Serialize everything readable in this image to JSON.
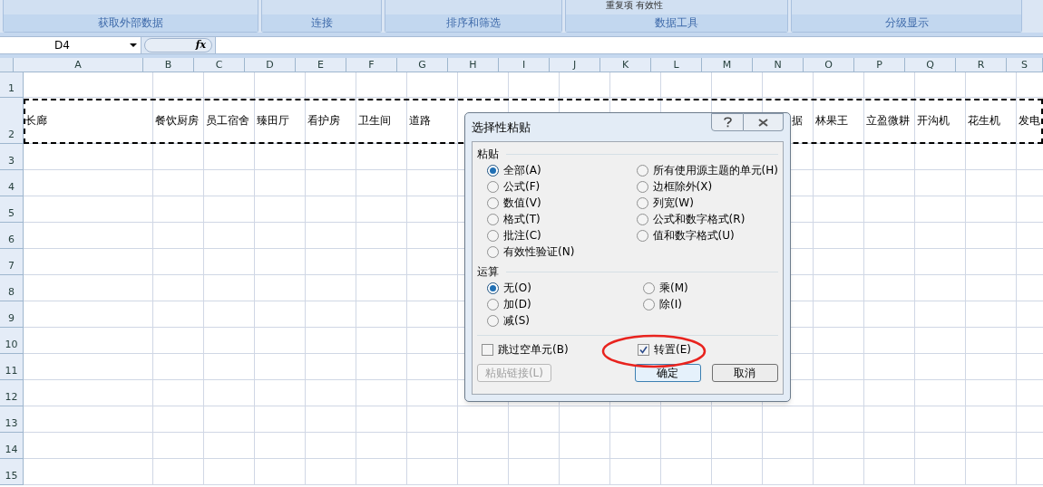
{
  "ribbon": {
    "partial_text": "重复项 有效性",
    "groups": [
      {
        "label": "获取外部数据"
      },
      {
        "label": "连接"
      },
      {
        "label": "排序和筛选"
      },
      {
        "label": "数据工具"
      },
      {
        "label": "分级显示"
      }
    ]
  },
  "formula_bar": {
    "name_box": "D4",
    "fx": "fx"
  },
  "sheet": {
    "columns": [
      "A",
      "B",
      "C",
      "D",
      "E",
      "F",
      "G",
      "H",
      "I",
      "J",
      "K",
      "L",
      "M",
      "N",
      "O",
      "P",
      "Q",
      "R",
      "S"
    ],
    "rows": [
      {
        "number": "1"
      },
      {
        "number": "2",
        "cells": [
          {
            "text": "长廊"
          },
          {
            "text": "餐饮厨房"
          },
          {
            "text": "员工宿舍"
          },
          {
            "text": "臻田厅"
          },
          {
            "text": "看护房"
          },
          {
            "text": "卫生间"
          },
          {
            "text": "道路"
          },
          {},
          {},
          {},
          {},
          {},
          {},
          {
            "text": "据"
          },
          {
            "text": "林果王"
          },
          {
            "text": "立盈微耕"
          },
          {
            "text": "开沟机"
          },
          {
            "text": "花生机"
          },
          {
            "text": "发电"
          }
        ]
      },
      {
        "number": "3"
      },
      {
        "number": "4"
      },
      {
        "number": "5"
      },
      {
        "number": "6"
      },
      {
        "number": "7"
      },
      {
        "number": "8"
      },
      {
        "number": "9"
      },
      {
        "number": "10"
      },
      {
        "number": "11"
      },
      {
        "number": "12"
      },
      {
        "number": "13"
      },
      {
        "number": "14"
      },
      {
        "number": "15"
      }
    ]
  },
  "dialog": {
    "title": "选择性粘贴",
    "paste": {
      "label": "粘贴",
      "left_options": [
        {
          "label": "全部(A)",
          "selected": true
        },
        {
          "label": "公式(F)",
          "selected": false
        },
        {
          "label": "数值(V)",
          "selected": false
        },
        {
          "label": "格式(T)",
          "selected": false
        },
        {
          "label": "批注(C)",
          "selected": false
        },
        {
          "label": "有效性验证(N)",
          "selected": false
        }
      ],
      "right_options": [
        {
          "label": "所有使用源主题的单元(H)",
          "selected": false
        },
        {
          "label": "边框除外(X)",
          "selected": false
        },
        {
          "label": "列宽(W)",
          "selected": false
        },
        {
          "label": "公式和数字格式(R)",
          "selected": false
        },
        {
          "label": "值和数字格式(U)",
          "selected": false
        }
      ]
    },
    "operation": {
      "label": "运算",
      "left_options": [
        {
          "label": "无(O)",
          "selected": true
        },
        {
          "label": "加(D)",
          "selected": false
        },
        {
          "label": "减(S)",
          "selected": false
        }
      ],
      "right_options": [
        {
          "label": "乘(M)",
          "selected": false
        },
        {
          "label": "除(I)",
          "selected": false
        }
      ]
    },
    "checkboxes": [
      {
        "label": "跳过空单元(B)",
        "checked": false
      },
      {
        "label": "转置(E)",
        "checked": true
      }
    ],
    "buttons": [
      {
        "label": "粘贴链接(L)",
        "disabled": true,
        "default": false
      },
      {
        "label": "确定",
        "disabled": false,
        "default": true
      },
      {
        "label": "取消",
        "disabled": false,
        "default": false
      }
    ]
  }
}
